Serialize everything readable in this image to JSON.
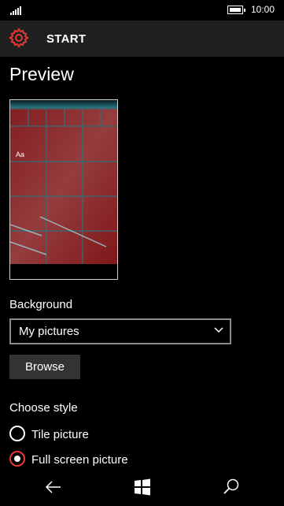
{
  "status": {
    "time": "10:00"
  },
  "header": {
    "title": "START"
  },
  "page": {
    "title": "Preview"
  },
  "preview": {
    "tile_text": "Aa"
  },
  "background": {
    "label": "Background",
    "selected": "My pictures",
    "browse_label": "Browse"
  },
  "style": {
    "label": "Choose style",
    "options": [
      {
        "label": "Tile picture",
        "selected": false
      },
      {
        "label": "Full screen picture",
        "selected": true
      }
    ]
  },
  "colors": {
    "accent": "#e53935",
    "tile": "#8b1518"
  },
  "icons": {
    "settings": "gear-icon",
    "back": "back-arrow-icon",
    "home": "windows-logo-icon",
    "search": "search-icon"
  }
}
